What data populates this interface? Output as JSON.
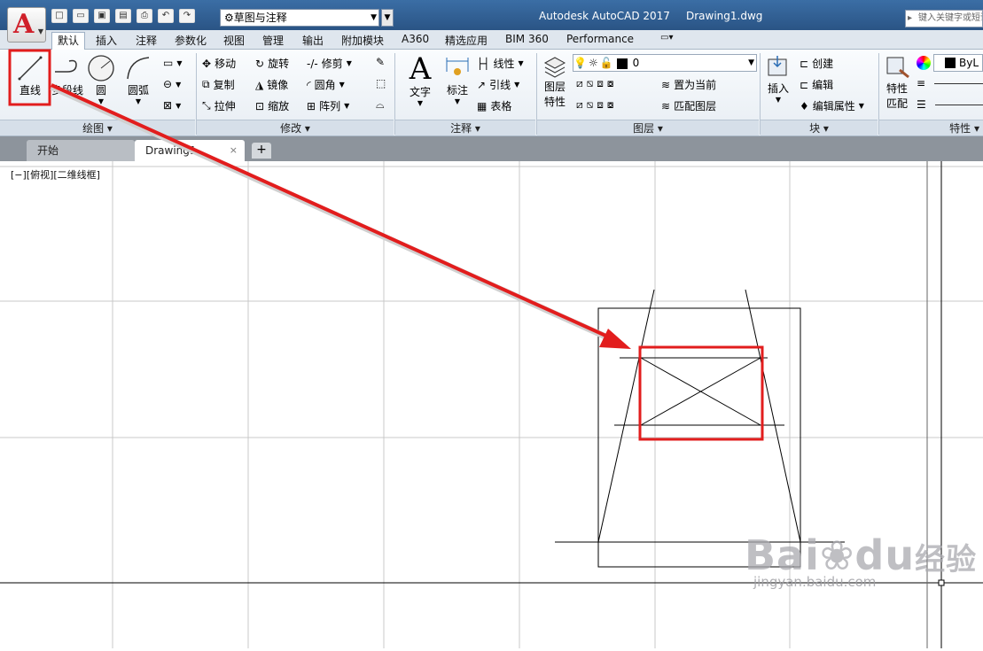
{
  "titlebar": {
    "app_title": "Autodesk AutoCAD 2017",
    "doc_title": "Drawing1.dwg",
    "workspace": "草图与注释",
    "search_placeholder": "键入关键字或短语"
  },
  "ribbon_tabs": [
    "默认",
    "插入",
    "注释",
    "参数化",
    "视图",
    "管理",
    "输出",
    "附加模块",
    "A360",
    "精选应用",
    "BIM 360",
    "Performance"
  ],
  "draw_panel": {
    "title": "绘图",
    "line": "直线",
    "polyline": "多段线",
    "circle": "圆",
    "arc": "圆弧"
  },
  "modify_panel": {
    "title": "修改",
    "move": "移动",
    "rotate": "旋转",
    "trim": "修剪",
    "copy": "复制",
    "mirror": "镜像",
    "fillet": "圆角",
    "stretch": "拉伸",
    "scale": "缩放",
    "array": "阵列"
  },
  "annotation_panel": {
    "title": "注释",
    "text": "文字",
    "dimension": "标注",
    "linear": "线性",
    "leader": "引线",
    "table": "表格"
  },
  "layers_panel": {
    "title": "图层",
    "layer_properties_1": "图层",
    "layer_properties_2": "特性",
    "current_layer": "0",
    "set_current": "置为当前",
    "match_layer": "匹配图层"
  },
  "block_panel": {
    "title": "块",
    "insert": "插入",
    "create": "创建",
    "edit": "编辑",
    "edit_attributes": "编辑属性"
  },
  "properties_panel": {
    "title": "特性",
    "match_1": "特性",
    "match_2": "匹配",
    "color_value": "ByL"
  },
  "doc_tabs": {
    "start": "开始",
    "drawing": "Drawing1",
    "close": "×",
    "new": "+"
  },
  "viewport_label": "[−][俯视][二维线框]",
  "watermark": {
    "brand": "Bai",
    "brand2": "du",
    "brand_cn": "经验",
    "url": "jingyan.baidu.com"
  },
  "colors": {
    "highlight": "#e21d1d",
    "grid": "#c8c8c8",
    "geometry": "#000000"
  }
}
